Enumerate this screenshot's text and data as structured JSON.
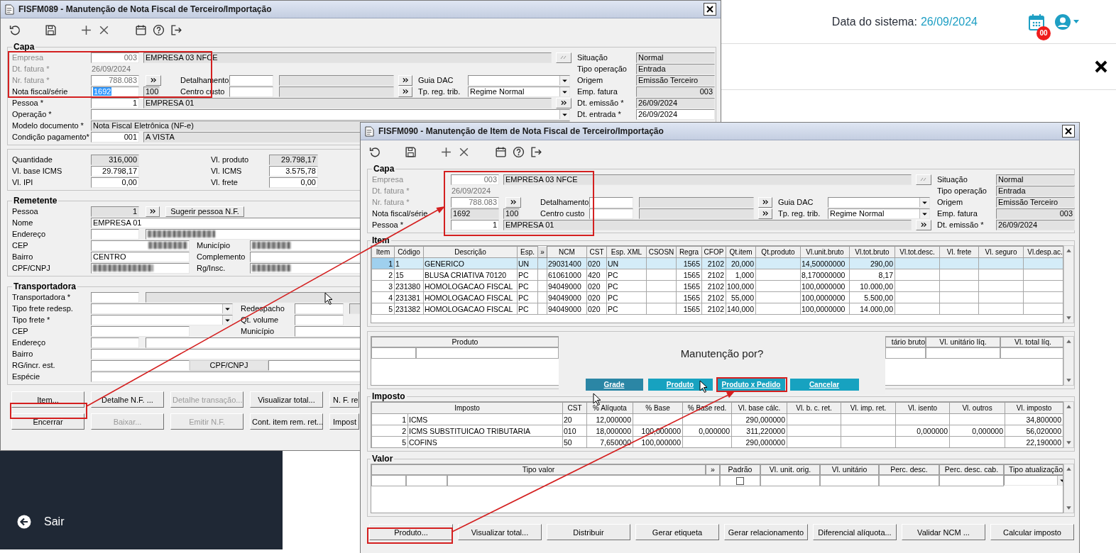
{
  "header": {
    "date_label": "Data do sistema:",
    "date": "26/09/2024",
    "badge": "00"
  },
  "sidebar": {
    "exit": "Sair"
  },
  "windows": [
    {
      "title": "FISFM089 - Manutenção de Nota Fiscal de Terceiro/Importação",
      "sections": [
        {
          "kind": "capa",
          "legend": "Capa",
          "empresa": {
            "label": "Empresa",
            "code": "003",
            "name": "EMPRESA 03 NFCE",
            "disabled": true
          },
          "dt_fatura": {
            "label": "Dt. fatura *",
            "value": "26/09/2024",
            "disabled": true
          },
          "nr_fatura": {
            "label": "Nr. fatura *",
            "value": "788.083",
            "disabled": true
          },
          "nota": {
            "label": "Nota fiscal/série",
            "value": "1692",
            "serie": "100",
            "selected": true
          },
          "detalhamento": "Detalhamento",
          "centro_custo": "Centro custo",
          "guia_dac": "Guia DAC",
          "tp_reg": {
            "label": "Tp. reg. trib.",
            "value": "Regime Normal"
          },
          "pessoa": {
            "label": "Pessoa *",
            "code": "1",
            "name": "EMPRESA 01"
          },
          "operacao": {
            "label": "Operação *"
          },
          "modelo": {
            "label": "Modelo documento *",
            "value": "Nota Fiscal Eletrônica (NF-e)"
          },
          "condicao": {
            "label": "Condição pagamento*",
            "code": "001",
            "name": "A VISTA"
          },
          "status": [
            {
              "label": "Situação",
              "value": "Normal",
              "kind": "text",
              "editable": false
            },
            {
              "label": "Tipo operação",
              "value": "Entrada",
              "kind": "text",
              "editable": false
            },
            {
              "label": "Origem",
              "value": "Emissão Terceiro",
              "kind": "text",
              "editable": false
            },
            {
              "label": "Emp. fatura",
              "value": "003",
              "kind": "number",
              "editable": false
            },
            {
              "label": "Dt. emissão *",
              "value": "26/09/2024",
              "kind": "text",
              "editable": false
            },
            {
              "label": "Dt. entrada *",
              "value": "26/09/2024",
              "kind": "text",
              "editable": true
            }
          ]
        },
        {
          "kind": "totals",
          "fields": [
            {
              "label": "Quantidade",
              "value": "316,000",
              "editable": false
            },
            {
              "label": "Vl. produto",
              "value": "29.798,17",
              "editable": false
            },
            {
              "label": "Vl. base ICMS",
              "value": "29.798,17",
              "editable": true
            },
            {
              "label": "Vl. ICMS",
              "value": "3.575,78",
              "editable": true
            },
            {
              "label": "Vl. IPI",
              "value": "0,00",
              "editable": true
            },
            {
              "label": "Vl. frete",
              "value": "0,00",
              "editable": true
            }
          ]
        },
        {
          "kind": "remetente",
          "legend": "Remetente",
          "pessoa": {
            "label": "Pessoa",
            "code": "1"
          },
          "suggest_button": "Sugerir pessoa N.F.",
          "nome": {
            "label": "Nome",
            "value": "EMPRESA 01"
          },
          "endereco": "Endereço",
          "cep": "CEP",
          "municipio": "Município",
          "bairro": {
            "label": "Bairro",
            "value": "CENTRO"
          },
          "complemento": "Complemento",
          "cpf_cnpj": "CPF/CNPJ",
          "rg_insc": "Rg/Insc."
        },
        {
          "kind": "transportadora",
          "legend": "Transportadora",
          "transportadora": "Transportadora *",
          "tipo_frete_redesp": "Tipo frete redesp.",
          "redespacho": "Redespacho",
          "tipo_frete": "Tipo frete *",
          "qt_volume": "Qt. volume",
          "cep": "CEP",
          "municipio": "Município",
          "endereco": "Endereço",
          "bairro": "Bairro",
          "rg": "RG/incr. est.",
          "cpf_cnpj": "CPF/CNPJ",
          "especie": "Espécie"
        },
        {
          "kind": "buttons",
          "rows": [
            [
              {
                "label": "Item...",
                "disabled": false
              },
              {
                "label": "Detalhe N.F. ...",
                "disabled": false
              },
              {
                "label": "Detalhe transação...",
                "disabled": true
              },
              {
                "label": "Visualizar total...",
                "disabled": false
              },
              {
                "label": "N. F. re",
                "disabled": false
              }
            ],
            [
              {
                "label": "Encerrar",
                "disabled": false
              },
              {
                "label": "Baixar...",
                "disabled": true
              },
              {
                "label": "Emitir N.F.",
                "disabled": true
              },
              {
                "label": "Cont. item rem. ret...",
                "disabled": false
              },
              {
                "label": "Impost",
                "disabled": false
              }
            ]
          ]
        }
      ]
    },
    {
      "title": "FISFM090 - Manutenção de Item de Nota Fiscal de Terceiro/Importação",
      "sections": [
        {
          "kind": "capa",
          "legend": "Capa",
          "empresa": {
            "label": "Empresa",
            "code": "003",
            "name": "EMPRESA 03 NFCE",
            "disabled": true
          },
          "dt_fatura": {
            "label": "Dt. fatura *",
            "value": "26/09/2024",
            "disabled": true
          },
          "nr_fatura": {
            "label": "Nr. fatura *",
            "value": "788.083",
            "disabled": true
          },
          "nota": {
            "label": "Nota fiscal/série",
            "value": "1692",
            "serie": "100",
            "selected": false
          },
          "detalhamento": "Detalhamento",
          "centro_custo": "Centro custo",
          "guia_dac": "Guia DAC",
          "tp_reg": {
            "label": "Tp. reg. trib.",
            "value": "Regime Normal"
          },
          "pessoa": {
            "label": "Pessoa *",
            "code": "1",
            "name": "EMPRESA 01"
          },
          "status": [
            {
              "label": "Situação",
              "value": "Normal",
              "kind": "text",
              "editable": false
            },
            {
              "label": "Tipo operação",
              "value": "Entrada",
              "kind": "text",
              "editable": false
            },
            {
              "label": "Origem",
              "value": "Emissão Terceiro",
              "kind": "text",
              "editable": false
            },
            {
              "label": "Emp. fatura",
              "value": "003",
              "kind": "number",
              "editable": false
            },
            {
              "label": "Dt. emissão *",
              "value": "26/09/2024",
              "kind": "text",
              "editable": false
            }
          ]
        },
        {
          "kind": "items",
          "legend": "Item",
          "columns": [
            {
              "label": "Item",
              "kind": "number"
            },
            {
              "label": "Código",
              "kind": "text"
            },
            {
              "label": "Descrição",
              "kind": "text"
            },
            {
              "label": "Esp.",
              "kind": "text"
            },
            {
              "label": "»",
              "kind": "button"
            },
            {
              "label": "NCM",
              "kind": "text"
            },
            {
              "label": "CST",
              "kind": "text"
            },
            {
              "label": "Esp. XML",
              "kind": "text"
            },
            {
              "label": "CSOSN",
              "kind": "text"
            },
            {
              "label": "Regra",
              "kind": "number"
            },
            {
              "label": "CFOP",
              "kind": "number"
            },
            {
              "label": "Qt.item",
              "kind": "number"
            },
            {
              "label": "Qt.produto",
              "kind": "number"
            },
            {
              "label": "Vl.unit.bruto",
              "kind": "text"
            },
            {
              "label": "Vl.tot.bruto",
              "kind": "number"
            },
            {
              "label": "Vl.tot.desc.",
              "kind": "number"
            },
            {
              "label": "Vl. frete",
              "kind": "number"
            },
            {
              "label": "Vl. seguro",
              "kind": "number"
            },
            {
              "label": "Vl.desp.ac.",
              "kind": "number"
            }
          ],
          "rows": [
            {
              "selected": true,
              "cells": [
                "1",
                "1",
                "GENERICO",
                "UN",
                null,
                "29031400",
                "020",
                "UN",
                null,
                "1565",
                "2102",
                "20,000",
                null,
                "14,50000000",
                "290,00",
                null,
                null,
                null,
                null
              ]
            },
            {
              "selected": false,
              "cells": [
                "2",
                "15",
                "BLUSA CRIATIVA 70120",
                "PC",
                null,
                "61061000",
                "420",
                "PC",
                null,
                "1565",
                "2102",
                "1,000",
                null,
                "8,170000000",
                "8,17",
                null,
                null,
                null,
                null
              ]
            },
            {
              "selected": false,
              "cells": [
                "3",
                "231380",
                "HOMOLOGACAO FISCAL",
                "PC",
                null,
                "94049000",
                "020",
                "PC",
                null,
                "1565",
                "2102",
                "100,000",
                null,
                "100,0000000",
                "10.000,00",
                null,
                null,
                null,
                null
              ]
            },
            {
              "selected": false,
              "cells": [
                "4",
                "231381",
                "HOMOLOGACAO FISCAL",
                "PC",
                null,
                "94049000",
                "020",
                "PC",
                null,
                "1565",
                "2102",
                "55,000",
                null,
                "100,0000000",
                "5.500,00",
                null,
                null,
                null,
                null
              ]
            },
            {
              "selected": false,
              "cells": [
                "5",
                "231382",
                "HOMOLOGACAO FISCAL",
                "PC",
                null,
                "94049000",
                "020",
                "PC",
                null,
                "1565",
                "2102",
                "140,000",
                null,
                "100,0000000",
                "14.000,00",
                null,
                null,
                null,
                null
              ]
            }
          ]
        },
        {
          "kind": "produto",
          "columns": [
            {
              "label": "Produto"
            },
            {
              "label": "tário bruto"
            },
            {
              "label": "Vl. unitário líq."
            },
            {
              "label": "Vl. total líq."
            }
          ],
          "dialog": {
            "title": "Manutenção por?",
            "buttons": [
              {
                "label": "Grade",
                "selected": true
              },
              {
                "label": "Produto",
                "selected": false
              },
              {
                "label": "Produto x Pedido",
                "selected": false
              },
              {
                "label": "Cancelar",
                "selected": false
              }
            ]
          }
        },
        {
          "kind": "imposto",
          "legend": "Imposto",
          "columns": [
            "Imposto",
            "CST",
            "% Alíquota",
            "% Base",
            "% Base red.",
            "Vl. base cálc.",
            "Vl. b. c. ret.",
            "Vl. imp. ret.",
            "Vl. isento",
            "Vl. outros",
            "Vl. imposto"
          ],
          "rows": [
            {
              "number": "1",
              "cells": [
                "ICMS",
                "20",
                "12,000000",
                null,
                null,
                "290,000000",
                null,
                null,
                null,
                null,
                "34,800000"
              ]
            },
            {
              "number": "2",
              "cells": [
                "ICMS SUBSTITUICAO TRIBUTARIA",
                "010",
                "18,000000",
                "100,000000",
                "0,000000",
                "311,220000",
                null,
                null,
                "0,000000",
                "0,000000",
                "56,020000"
              ]
            },
            {
              "number": "5",
              "cells": [
                "COFINS",
                "50",
                "7,650000",
                "100,000000",
                null,
                "290,000000",
                null,
                null,
                null,
                null,
                "22,190000"
              ]
            }
          ]
        },
        {
          "kind": "valor",
          "legend": "Valor",
          "columns": [
            "Tipo valor",
            "»",
            "Padrão",
            "Vl. unit. orig.",
            "Vl. unitário",
            "Perc. desc.",
            "Perc. desc. cab.",
            "Tipo atualização"
          ],
          "rows": [
            {
              "checked": false
            }
          ]
        },
        {
          "kind": "buttons",
          "rows": [
            [
              {
                "label": "Produto...",
                "disabled": false
              },
              {
                "label": "Visualizar total...",
                "disabled": false
              },
              {
                "label": "Distribuir",
                "disabled": false
              },
              {
                "label": "Gerar etiqueta",
                "disabled": false
              },
              {
                "label": "Gerar relacionamento",
                "disabled": false
              },
              {
                "label": "Diferencial alíquota...",
                "disabled": false
              },
              {
                "label": "Validar NCM ...",
                "disabled": false
              },
              {
                "label": "Calcular imposto",
                "disabled": false
              }
            ]
          ]
        }
      ]
    }
  ]
}
